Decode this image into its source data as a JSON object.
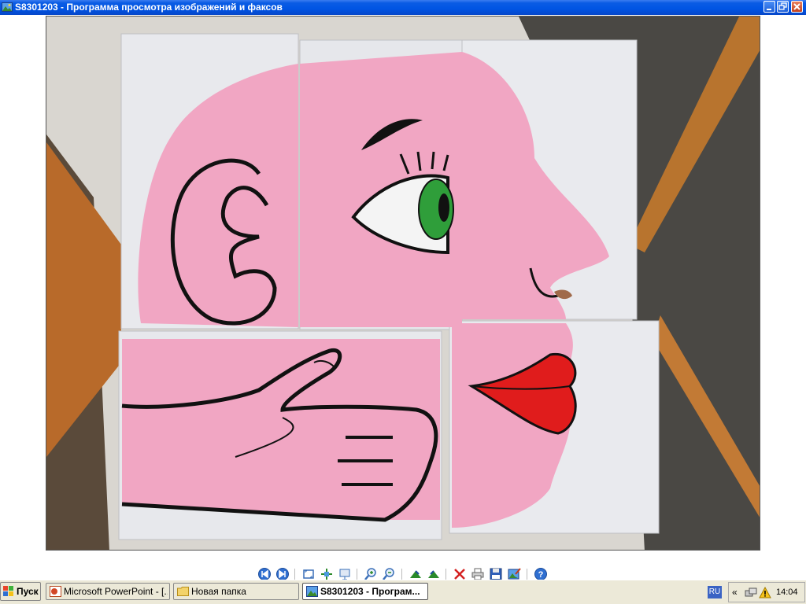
{
  "window": {
    "title": "S8301203 - Программа просмотра изображений и факсов",
    "controls": [
      "minimize-icon",
      "restore-icon",
      "close-icon"
    ]
  },
  "viewer": {
    "image_description_icon": "image-viewer-photo",
    "toolbar": [
      {
        "name": "previous-image-button",
        "icon": "previous-icon"
      },
      {
        "name": "next-image-button",
        "icon": "next-icon"
      },
      {
        "name": "best-fit-button",
        "icon": "best-fit-icon"
      },
      {
        "name": "actual-size-button",
        "icon": "actual-size-icon"
      },
      {
        "name": "slideshow-button",
        "icon": "slideshow-icon"
      },
      {
        "name": "zoom-in-button",
        "icon": "zoom-in-icon"
      },
      {
        "name": "zoom-out-button",
        "icon": "zoom-out-icon"
      },
      {
        "name": "rotate-clockwise-button",
        "icon": "rotate-cw-icon"
      },
      {
        "name": "rotate-counterclockwise-button",
        "icon": "rotate-ccw-icon"
      },
      {
        "name": "delete-button",
        "icon": "delete-icon"
      },
      {
        "name": "print-button",
        "icon": "print-icon"
      },
      {
        "name": "save-button",
        "icon": "save-icon"
      },
      {
        "name": "open-for-editing-button",
        "icon": "edit-icon"
      },
      {
        "name": "help-button",
        "icon": "help-icon"
      }
    ]
  },
  "taskbar": {
    "start_label": "Пуск",
    "tasks": [
      {
        "label": "Microsoft PowerPoint - [...",
        "icon": "powerpoint-icon",
        "active": false
      },
      {
        "label": "Новая папка",
        "icon": "folder-icon",
        "active": false
      },
      {
        "label": "S8301203 - Програм...",
        "icon": "image-viewer-icon",
        "active": true
      }
    ],
    "language": "RU",
    "tray_expand": "«",
    "clock": "14:04"
  },
  "colors": {
    "titlebar": "#0054e3",
    "face_pink": "#f1a6c3",
    "lips_red": "#e01c1c",
    "eye_green": "#2f9e3a",
    "board_white": "#e9eaee"
  }
}
